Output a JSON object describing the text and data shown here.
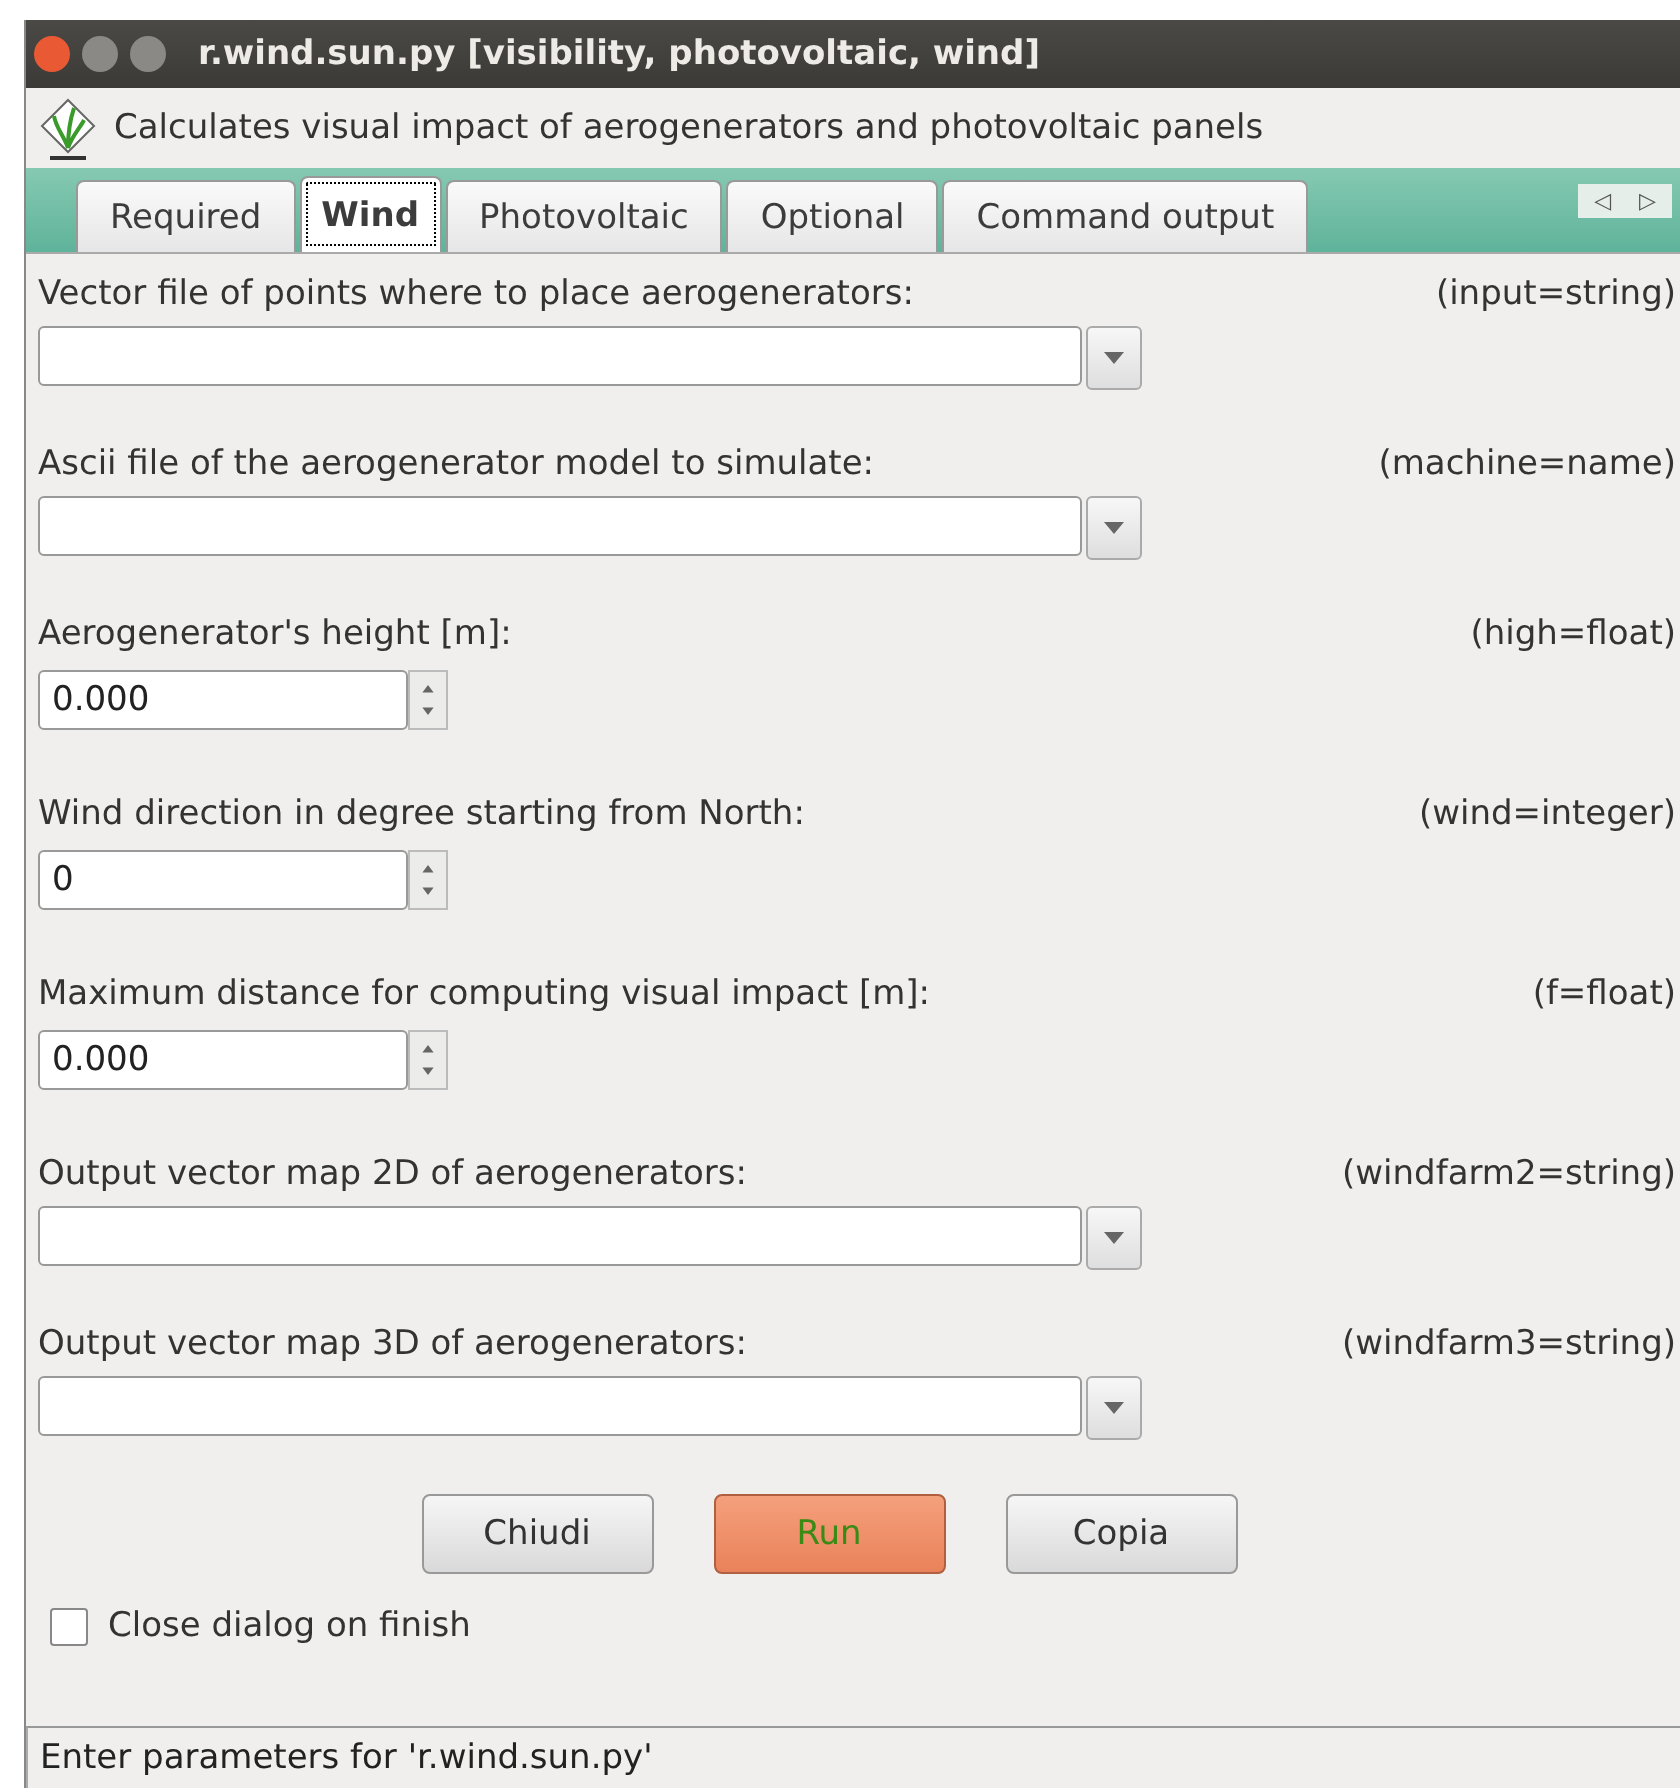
{
  "window": {
    "title": "r.wind.sun.py [visibility, photovoltaic, wind]"
  },
  "description": "Calculates visual impact of aerogenerators and photovoltaic panels",
  "tabs": [
    {
      "label": "Required",
      "selected": false
    },
    {
      "label": "Wind",
      "selected": true
    },
    {
      "label": "Photovoltaic",
      "selected": false
    },
    {
      "label": "Optional",
      "selected": false
    },
    {
      "label": "Command output",
      "selected": false
    }
  ],
  "tab_scroll": {
    "left": "◁",
    "right": "▷"
  },
  "fields": [
    {
      "kind": "combo",
      "label": "Vector file of points where to place aerogenerators:",
      "param": "(input=string)"
    },
    {
      "kind": "combo",
      "label": "Ascii file of the aerogenerator model to simulate:",
      "param": "(machine=name)"
    },
    {
      "kind": "spin",
      "label": "Aerogenerator's height [m]:",
      "param": "(high=float)",
      "value": "0.000"
    },
    {
      "kind": "spin",
      "label": "Wind direction in degree starting from North:",
      "param": "(wind=integer)",
      "value": "0"
    },
    {
      "kind": "spin",
      "label": "Maximum distance for computing visual impact [m]:",
      "param": "(f=float)",
      "value": "0.000"
    },
    {
      "kind": "combo",
      "label": "Output vector map 2D of aerogenerators:",
      "param": "(windfarm2=string)"
    },
    {
      "kind": "combo",
      "label": "Output vector map 3D of aerogenerators:",
      "param": "(windfarm3=string)"
    }
  ],
  "buttons": [
    {
      "label": "Chiudi",
      "kind": "normal"
    },
    {
      "label": "Run",
      "kind": "primary"
    },
    {
      "label": "Copia",
      "kind": "normal"
    }
  ],
  "close_on_finish": {
    "label": "Close dialog on finish",
    "checked": false
  },
  "status_bar": "Enter parameters for 'r.wind.sun.py'"
}
